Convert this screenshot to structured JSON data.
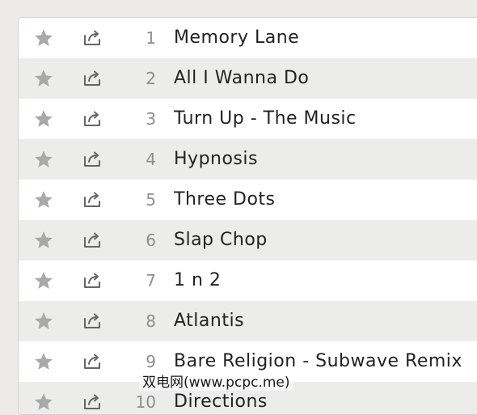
{
  "tracks": [
    {
      "number": "1",
      "title": "Memory Lane"
    },
    {
      "number": "2",
      "title": "All I Wanna Do"
    },
    {
      "number": "3",
      "title": "Turn Up - The Music"
    },
    {
      "number": "4",
      "title": "Hypnosis"
    },
    {
      "number": "5",
      "title": "Three Dots"
    },
    {
      "number": "6",
      "title": "Slap Chop"
    },
    {
      "number": "7",
      "title": "1 n 2"
    },
    {
      "number": "8",
      "title": "Atlantis"
    },
    {
      "number": "9",
      "title": "Bare Religion - Subwave Remix"
    },
    {
      "number": "10",
      "title": "Directions"
    }
  ],
  "icons": {
    "star": "star-icon",
    "share": "share-icon"
  },
  "watermark": "双电网(www.pcpc.me)",
  "colors": {
    "row_alt": "#ececea",
    "star": "#a9a9a9",
    "share": "#666666",
    "number": "#8e8e8e",
    "title": "#222222"
  }
}
